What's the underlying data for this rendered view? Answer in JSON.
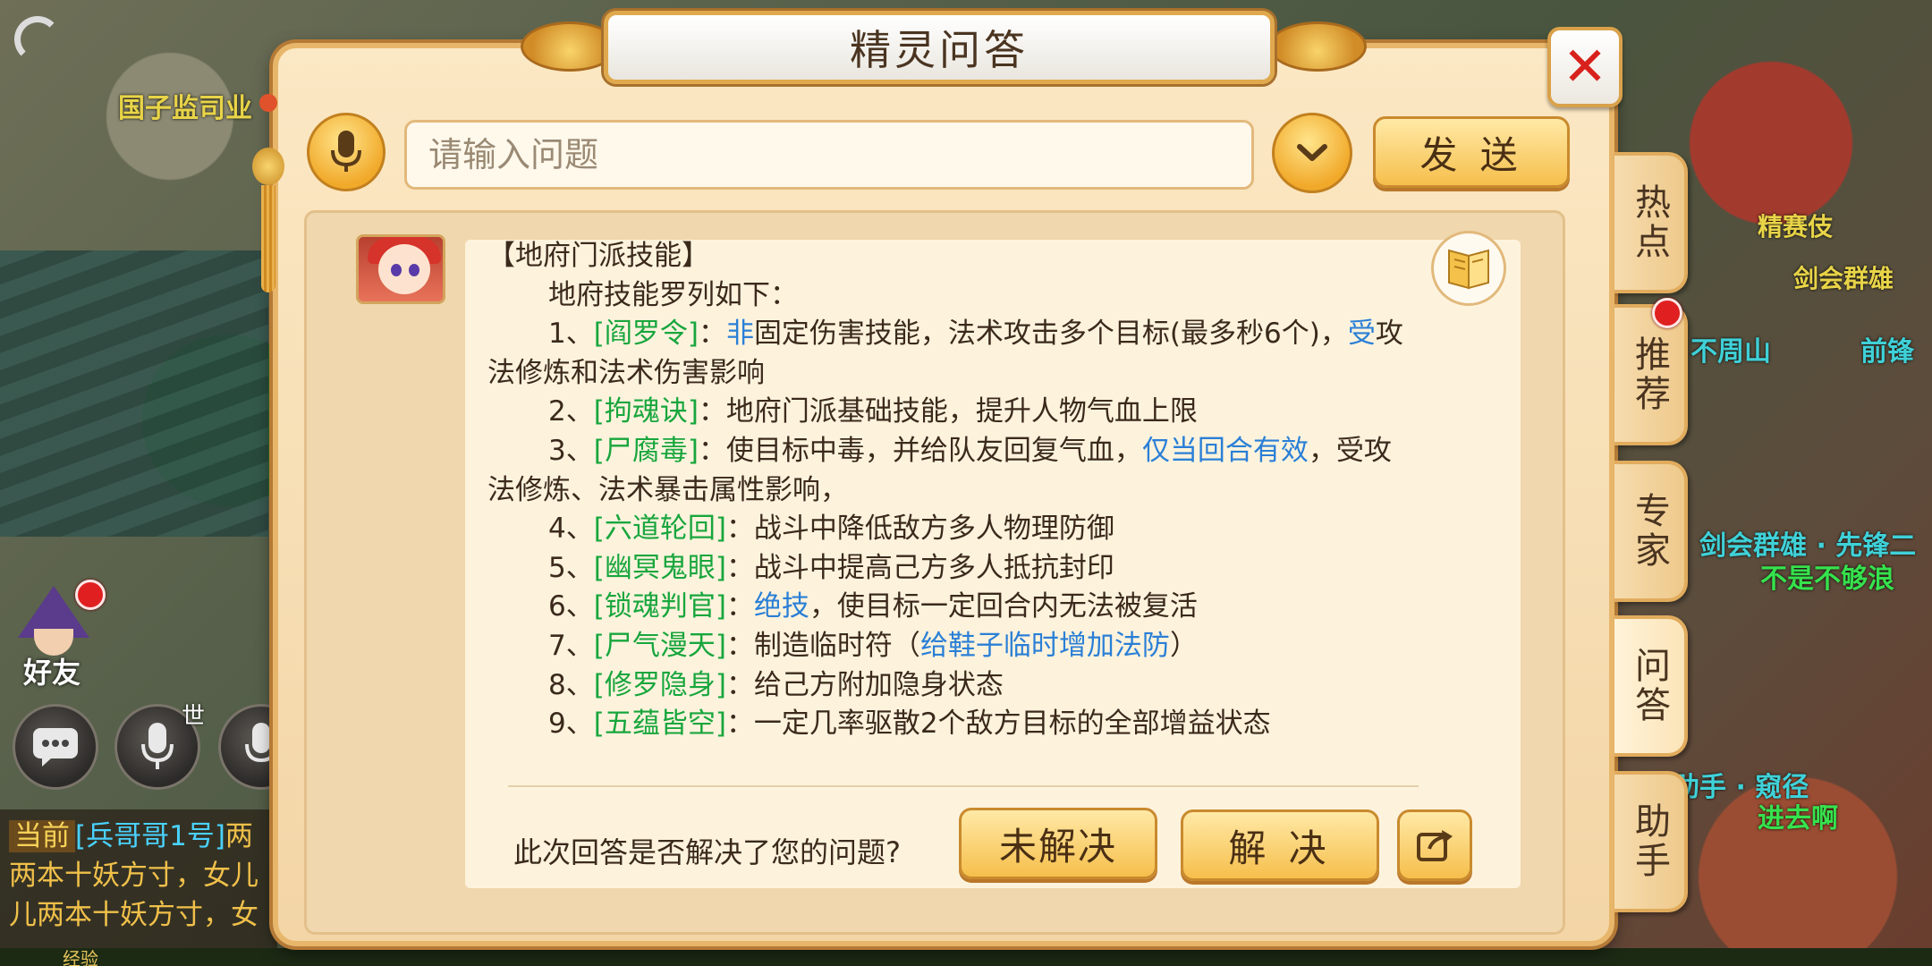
{
  "background": {
    "labels": [
      {
        "text": "国子监司业",
        "color": "yellow"
      },
      {
        "text": "精赛伎",
        "color": "yellow"
      },
      {
        "text": "剑会群雄",
        "color": "yellow"
      },
      {
        "text": "不周山",
        "color": "cyan"
      },
      {
        "text": "前锋",
        "color": "cyan"
      },
      {
        "text": "剑会群雄 · 先锋二",
        "color": "cyan"
      },
      {
        "text": "不是不够浪",
        "color": "green"
      },
      {
        "text": "助手 · 窥径",
        "color": "cyan"
      },
      {
        "text": "进去啊",
        "color": "green"
      }
    ]
  },
  "left_ui": {
    "friends_label": "好友",
    "world_channel_tag": "世",
    "chat": {
      "tag": "当前",
      "name": "[兵哥哥1号]",
      "line1_text": "两",
      "line2": "两本十妖方寸，女儿",
      "line3": "儿两本十妖方寸，女"
    },
    "exp_label": "经验"
  },
  "dialog": {
    "title": "精灵问答",
    "search": {
      "placeholder": "请输入问题",
      "value": ""
    },
    "send_label": "发 送",
    "answer": {
      "heading": "【地府门派技能】",
      "intro": "地府技能罗列如下：",
      "items": [
        {
          "num": "1、",
          "skill": "[阎罗令]",
          "desc_a": "：",
          "hl_a": "非",
          "desc_b": "固定伤害技能，法术攻击多个目标(最多秒6个)，",
          "hl_b": "受",
          "desc_c": "攻"
        },
        {
          "num": "2、",
          "skill": "[拘魂诀]",
          "desc": "：地府门派基础技能，提升人物气血上限"
        },
        {
          "num": "3、",
          "skill": "[尸腐毒]",
          "desc_a": "：使目标中毒，并给队友回复气血，",
          "hl_a": "仅当回合有效",
          "desc_b": "，受攻"
        },
        {
          "num": "4、",
          "skill": "[六道轮回]",
          "desc": "：战斗中降低敌方多人物理防御"
        },
        {
          "num": "5、",
          "skill": "[幽冥鬼眼]",
          "desc": "：战斗中提高己方多人抵抗封印"
        },
        {
          "num": "6、",
          "skill": "[锁魂判官]",
          "desc_a": "：",
          "hl_a": "绝技",
          "desc_b": "，使目标一定回合内无法被复活"
        },
        {
          "num": "7、",
          "skill": "[尸气漫天]",
          "desc_a": "：制造临时符（",
          "hl_a": "给鞋子临时增加法防",
          "desc_b": "）"
        },
        {
          "num": "8、",
          "skill": "[修罗隐身]",
          "desc": "：给己方附加隐身状态"
        },
        {
          "num": "9、",
          "skill": "[五蕴皆空]",
          "desc": "：一定几率驱散2个敌方目标的全部增益状态"
        }
      ],
      "wrap1": "法修炼和法术伤害影响",
      "wrap3": "法修炼、法术暴击属性影响，"
    },
    "feedback": {
      "question": "此次回答是否解决了您的问题?",
      "unsolved_label": "未解决",
      "solved_label": "解 决"
    }
  },
  "side_tabs": [
    {
      "label": "热点",
      "active": false,
      "badge": false
    },
    {
      "label": "推荐",
      "active": false,
      "badge": true
    },
    {
      "label": "专家",
      "active": false,
      "badge": false
    },
    {
      "label": "问答",
      "active": true,
      "badge": false
    },
    {
      "label": "助手",
      "active": false,
      "badge": false
    }
  ],
  "colors": {
    "skill_green": "#18a63d",
    "highlight_blue": "#2a7fd6",
    "close_red": "#d8211c",
    "button_gold": "#f6bf4c"
  }
}
